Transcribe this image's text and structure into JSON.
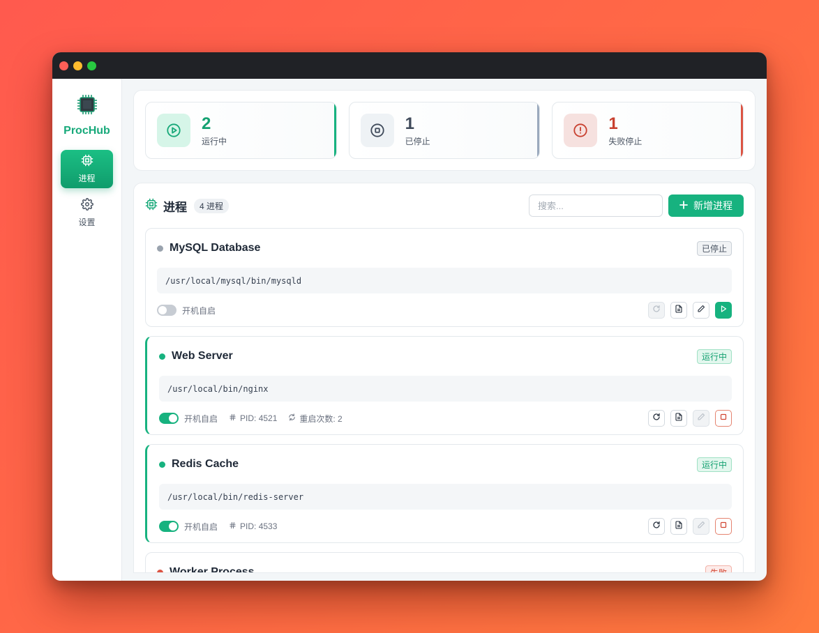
{
  "window": {
    "controls": [
      "close",
      "minimize",
      "zoom"
    ]
  },
  "sidebar": {
    "app_name": "ProcHub",
    "logo_icon": "cpu-chip-icon",
    "nav": [
      {
        "label": "进程",
        "icon": "cpu-icon",
        "active": true
      },
      {
        "label": "设置",
        "icon": "gear-icon",
        "active": false
      }
    ]
  },
  "stats": [
    {
      "value": "2",
      "label": "运行中",
      "icon": "play-circle-icon",
      "color": "#17b27f"
    },
    {
      "value": "1",
      "label": "已停止",
      "icon": "stop-circle-icon",
      "color": "#9aa9bd"
    },
    {
      "value": "1",
      "label": "失败停止",
      "icon": "alert-circle-icon",
      "color": "#dc5443"
    }
  ],
  "processes_panel": {
    "title": "进程",
    "count_label": "4 进程",
    "search_placeholder": "搜索...",
    "add_button_label": "新增进程"
  },
  "processes": [
    {
      "name": "MySQL Database",
      "status": "已停止",
      "status_type": "stopped",
      "command": "/usr/local/mysql/bin/mysqld",
      "autostart_label": "开机自启",
      "autostart": false
    },
    {
      "name": "Web Server",
      "status": "运行中",
      "status_type": "running",
      "command": "/usr/local/bin/nginx",
      "autostart_label": "开机自启",
      "autostart": true,
      "pid_label": "PID: 4521",
      "restarts_label": "重启次数: 2"
    },
    {
      "name": "Redis Cache",
      "status": "运行中",
      "status_type": "running",
      "command": "/usr/local/bin/redis-server",
      "autostart_label": "开机自启",
      "autostart": true,
      "pid_label": "PID: 4533"
    },
    {
      "name": "Worker Process",
      "status": "失败",
      "status_type": "failed"
    }
  ],
  "colors": {
    "accent": "#17b27f",
    "stopped": "#9aa9bd",
    "failed": "#dc5443"
  }
}
